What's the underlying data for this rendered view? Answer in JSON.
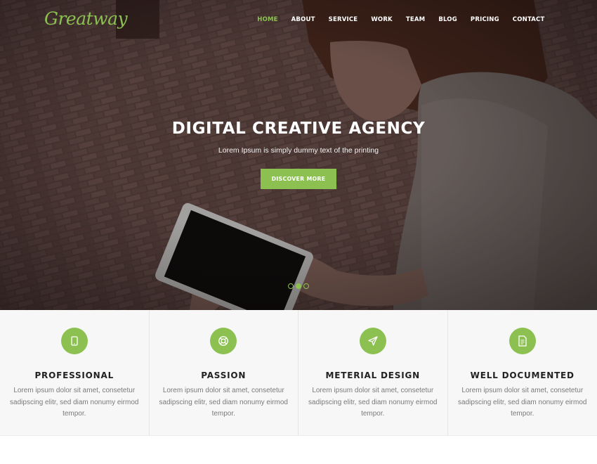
{
  "brand": {
    "logo_text": "Greatway",
    "accent_color": "#8cc152"
  },
  "nav": {
    "items": [
      {
        "label": "HOME",
        "active": true
      },
      {
        "label": "ABOUT"
      },
      {
        "label": "SERVICE"
      },
      {
        "label": "WORK"
      },
      {
        "label": "TEAM"
      },
      {
        "label": "BLOG"
      },
      {
        "label": "PRICING"
      },
      {
        "label": "CONTACT"
      }
    ]
  },
  "hero": {
    "title": "DIGITAL CREATIVE AGENCY",
    "subtitle": "Lorem Ipsum is simply dummy text of the printing",
    "button_label": "DISCOVER MORE",
    "slides": {
      "count": 3,
      "active_index": 1
    }
  },
  "features": [
    {
      "icon": "tablet-icon",
      "title": "PROFESSIONAL",
      "text": "Lorem ipsum dolor sit amet, consetetur sadipscing elitr, sed diam nonumy eirmod tempor."
    },
    {
      "icon": "lifebuoy-icon",
      "title": "PASSION",
      "text": "Lorem ipsum dolor sit amet, consetetur sadipscing elitr, sed diam nonumy eirmod tempor."
    },
    {
      "icon": "paper-plane-icon",
      "title": "METERIAL DESIGN",
      "text": "Lorem ipsum dolor sit amet, consetetur sadipscing elitr, sed diam nonumy eirmod tempor."
    },
    {
      "icon": "document-icon",
      "title": "WELL DOCUMENTED",
      "text": "Lorem ipsum dolor sit amet, consetetur sadipscing elitr, sed diam nonumy eirmod tempor."
    }
  ]
}
